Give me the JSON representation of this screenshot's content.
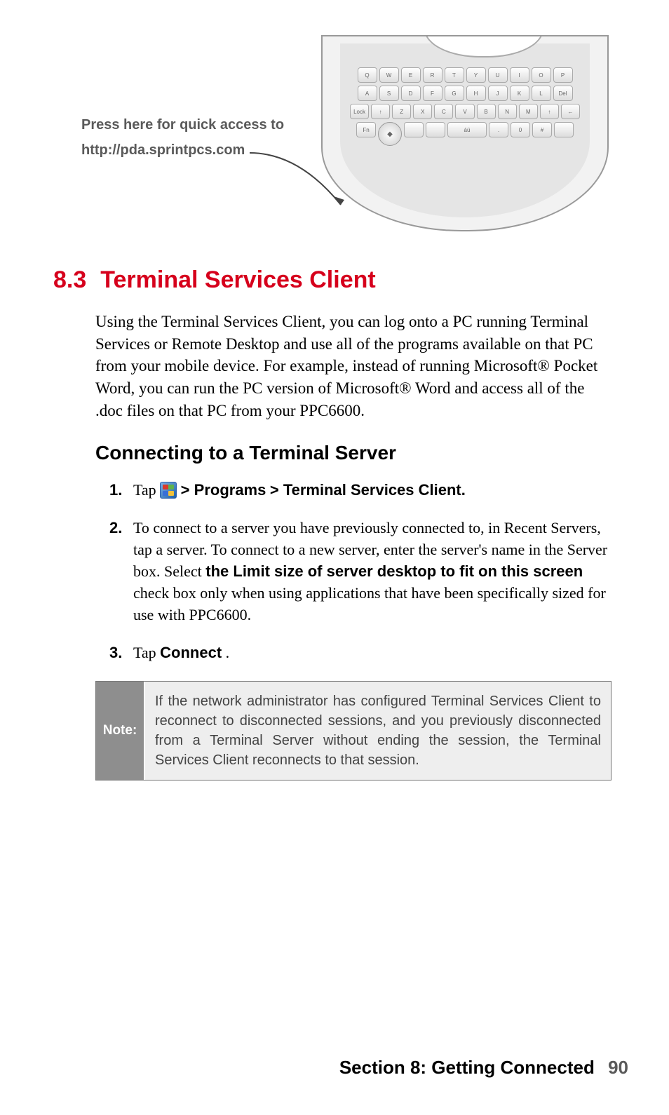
{
  "callout": {
    "line1": "Press here for quick access to",
    "line2": "http://pda.sprintpcs.com"
  },
  "keyboard": {
    "row1": [
      "Q",
      "W",
      "E",
      "R",
      "T",
      "Y",
      "U",
      "I",
      "O",
      "P"
    ],
    "row2": [
      "A",
      "S",
      "D",
      "F",
      "G",
      "H",
      "J",
      "K",
      "L",
      "Del"
    ],
    "row3": [
      "Lock",
      "↑",
      "Z",
      "X",
      "C",
      "V",
      "B",
      "N",
      "M",
      "↑",
      "←"
    ],
    "row4": [
      "Fn",
      "",
      "",
      "",
      "áü",
      ".",
      "0",
      "#",
      ""
    ]
  },
  "section": {
    "number": "8.3",
    "title": "Terminal Services Client"
  },
  "intro_para": "Using the Terminal Services Client, you can log onto a PC running Terminal Services or Remote Desktop and use all of the programs available on that PC from your mobile device. For example, instead of running Microsoft® Pocket Word, you can run the PC version of Microsoft®  Word and access all of the .doc files on that PC from your PPC6600.",
  "subheading": "Connecting to a Terminal Server",
  "steps": {
    "s1": {
      "num": "1.",
      "pre": "Tap ",
      "gt": " > ",
      "programs": "Programs",
      "gt2": " > ",
      "tsc": "Terminal Services Client."
    },
    "s2": {
      "num": "2.",
      "text_a": "To connect to a server you have previously connected to, in Recent Servers, tap a server.  To connect to a new server, enter the server's name in the Server box. Select ",
      "bold": "the Limit size of server desktop to fit on this screen",
      "text_b": " check box only when using applications that have been specifically sized for use with PPC6600."
    },
    "s3": {
      "num": "3.",
      "pre": "Tap ",
      "connect": "Connect",
      "period": "."
    }
  },
  "note": {
    "label": "Note:",
    "body": "If the network administrator has configured Terminal Services Client to reconnect to disconnected sessions, and you previously disconnected from a Terminal Server without ending the session, the Terminal Services Client reconnects to that session."
  },
  "footer": {
    "section": "Section 8: Getting Connected",
    "page": "90"
  }
}
